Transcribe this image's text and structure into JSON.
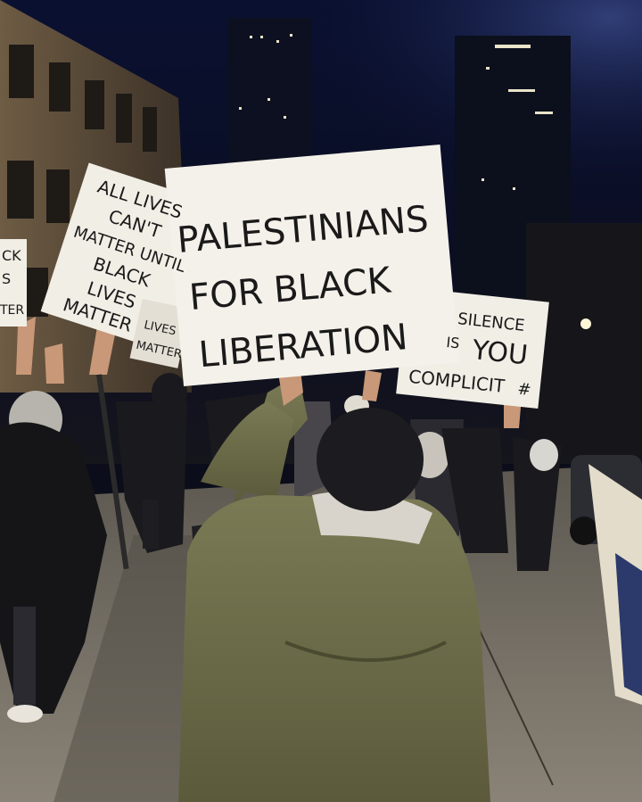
{
  "scene": {
    "description_colors": {
      "sky": "#0a0f24",
      "street": "#6f6a60",
      "jacket": "#6b6a45",
      "sign": "#f1eee6",
      "ink": "#1b1b1b"
    }
  },
  "signs": {
    "main": {
      "line1": "PALESTINIANS",
      "line2": "FOR BLACK",
      "line3": "LIBERATION"
    },
    "left": {
      "line1": "ALL LIVES",
      "line2": "CAN'T",
      "line3": "MATTER UNTIL",
      "line4": "BLACK",
      "line5": "LIVES",
      "line6": "MATTER"
    },
    "right": {
      "line1": "SILENCE",
      "line2": "IS",
      "line3": "YOU",
      "line4": "COMPLICIT",
      "line5": "#"
    },
    "far_left": {
      "line1": "CK",
      "line2": "S",
      "line3": "TER"
    },
    "small": {
      "line1": "LIVES",
      "line2": "MATTER"
    }
  }
}
